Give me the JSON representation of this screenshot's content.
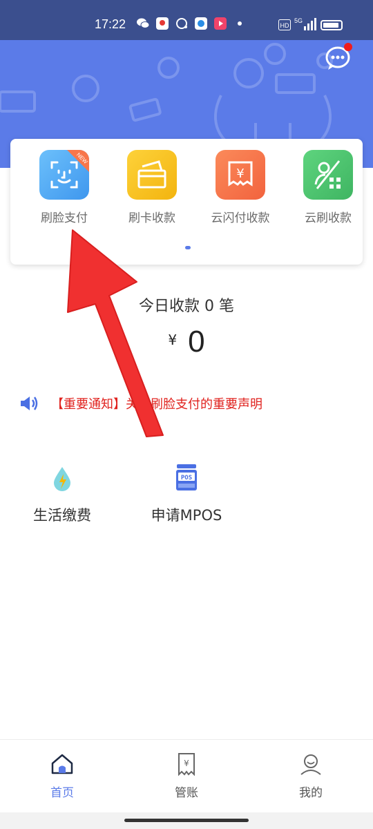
{
  "status_bar": {
    "time": "17:22",
    "network": "5G",
    "hd": "HD",
    "app_icons": [
      "wechat-icon",
      "location-app-icon",
      "chat-app-icon",
      "circle-app-icon",
      "video-app-icon"
    ]
  },
  "header": {
    "message_icon": "message-bubble-icon",
    "has_unread": true
  },
  "quick_functions": [
    {
      "label": "刷脸支付",
      "icon": "face-scan-icon",
      "color": "#4aa8f4",
      "badge": "NEW"
    },
    {
      "label": "刷卡收款",
      "icon": "card-swipe-icon",
      "color": "#f7c21b"
    },
    {
      "label": "云闪付收款",
      "icon": "yuan-receipt-icon",
      "color": "#f8764a"
    },
    {
      "label": "云刷收款",
      "icon": "qr-scan-icon",
      "color": "#4dc66f"
    }
  ],
  "stats": {
    "today_label": "今日收款 0 笔",
    "currency": "¥",
    "amount": "0"
  },
  "notice": {
    "text": "【重要通知】关于刷脸支付的重要声明"
  },
  "services": [
    {
      "label": "生活缴费",
      "icon": "water-drop-icon"
    },
    {
      "label": "申请MPOS",
      "icon": "pos-terminal-icon"
    }
  ],
  "tabs": [
    {
      "label": "首页",
      "icon": "home-icon",
      "active": true
    },
    {
      "label": "管账",
      "icon": "ledger-icon",
      "active": false
    },
    {
      "label": "我的",
      "icon": "profile-icon",
      "active": false
    }
  ],
  "colors": {
    "brand": "#5b7be8",
    "notice_red": "#e0221e",
    "status_bar": "#3b4f8e"
  }
}
